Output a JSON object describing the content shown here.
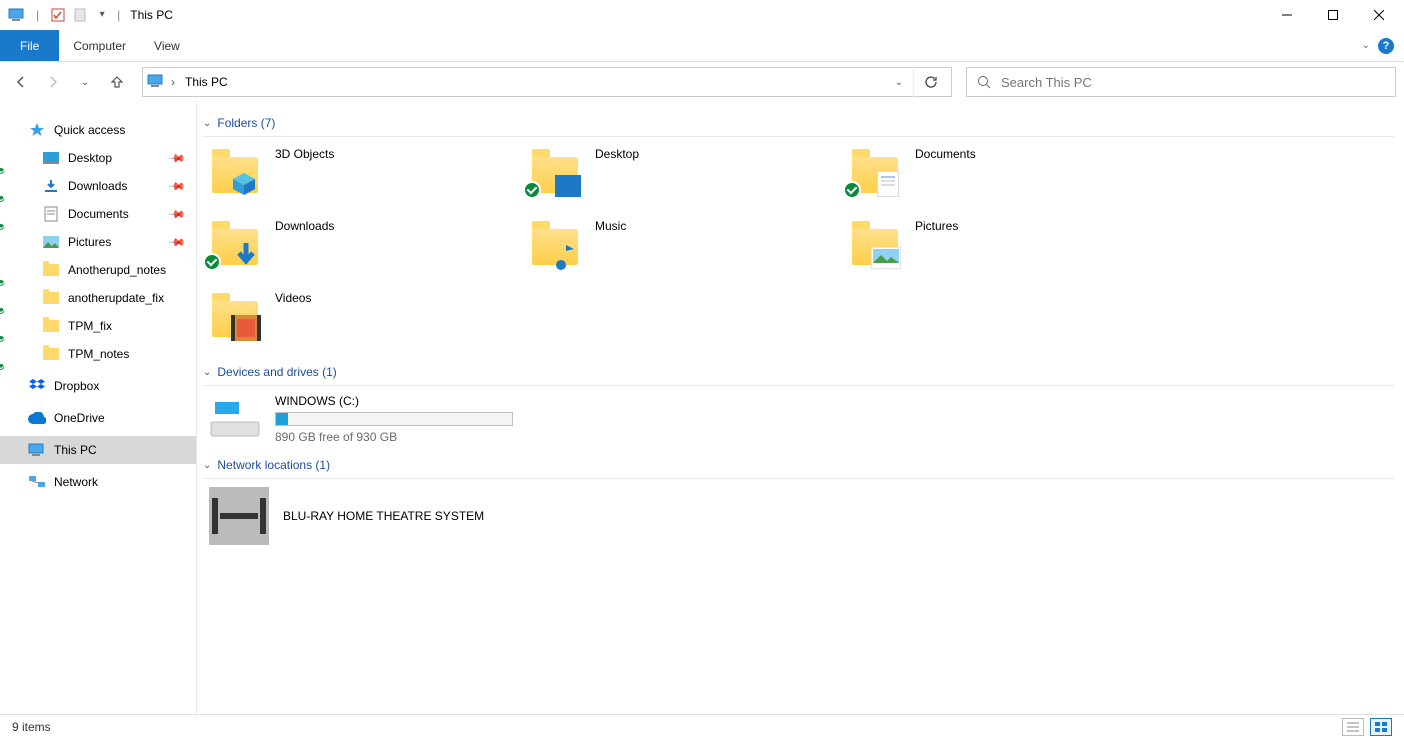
{
  "title": "This PC",
  "ribbon": {
    "file": "File",
    "tabs": [
      "Computer",
      "View"
    ]
  },
  "address": {
    "crumb": "This PC"
  },
  "search": {
    "placeholder": "Search This PC"
  },
  "nav": {
    "quick_access": "Quick access",
    "quick_items": [
      {
        "label": "Desktop",
        "pinned": true
      },
      {
        "label": "Downloads",
        "pinned": true
      },
      {
        "label": "Documents",
        "pinned": true
      },
      {
        "label": "Pictures",
        "pinned": true
      },
      {
        "label": "Anotherupd_notes",
        "pinned": false
      },
      {
        "label": "anotherupdate_fix",
        "pinned": false
      },
      {
        "label": "TPM_fix",
        "pinned": false
      },
      {
        "label": "TPM_notes",
        "pinned": false
      }
    ],
    "dropbox": "Dropbox",
    "onedrive": "OneDrive",
    "this_pc": "This PC",
    "network": "Network"
  },
  "groups": {
    "folders": {
      "header": "Folders (7)",
      "items": [
        "3D Objects",
        "Desktop",
        "Documents",
        "Downloads",
        "Music",
        "Pictures",
        "Videos"
      ]
    },
    "drives": {
      "header": "Devices and drives (1)",
      "drive": {
        "name": "WINDOWS (C:)",
        "free_text": "890 GB free of 930 GB",
        "fill_pct": 5
      }
    },
    "network": {
      "header": "Network locations (1)",
      "item": "BLU-RAY HOME THEATRE SYSTEM"
    }
  },
  "status": {
    "text": "9 items"
  }
}
